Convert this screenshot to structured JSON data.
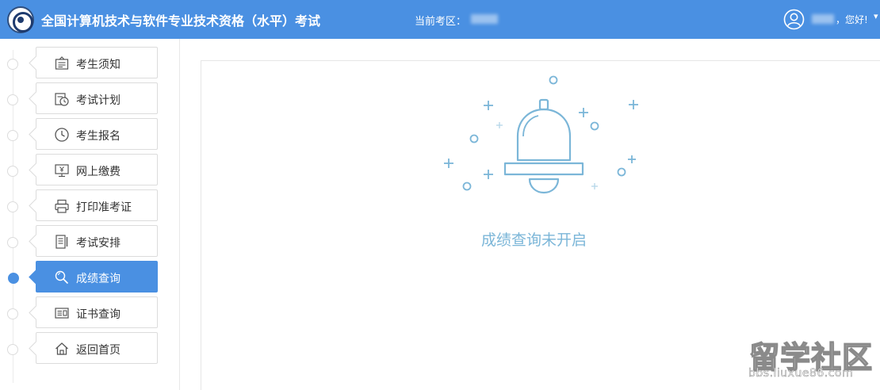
{
  "header": {
    "title": "全国计算机技术与软件专业技术资格（水平）考试",
    "exam_area_label": "当前考区：",
    "greeting": "，您好!",
    "caret": "▾"
  },
  "sidebar": {
    "items": [
      {
        "label": "考生须知",
        "icon": "notice-icon",
        "active": false
      },
      {
        "label": "考试计划",
        "icon": "calendar-clock-icon",
        "active": false
      },
      {
        "label": "考生报名",
        "icon": "clock-icon",
        "active": false
      },
      {
        "label": "网上缴费",
        "icon": "payment-monitor-icon",
        "active": false
      },
      {
        "label": "打印准考证",
        "icon": "printer-icon",
        "active": false
      },
      {
        "label": "考试安排",
        "icon": "document-icon",
        "active": false
      },
      {
        "label": "成绩查询",
        "icon": "search-icon",
        "active": true
      },
      {
        "label": "证书查询",
        "icon": "certificate-icon",
        "active": false
      },
      {
        "label": "返回首页",
        "icon": "home-icon",
        "active": false
      }
    ]
  },
  "main": {
    "message": "成绩查询未开启",
    "illustration": "bell-icon"
  },
  "watermark": {
    "brand": "留学社区",
    "url": "bbs.liuxue86.com"
  },
  "colors": {
    "primary": "#4a90e2",
    "illustration": "#7bb6d8",
    "message": "#7bb6d8"
  }
}
